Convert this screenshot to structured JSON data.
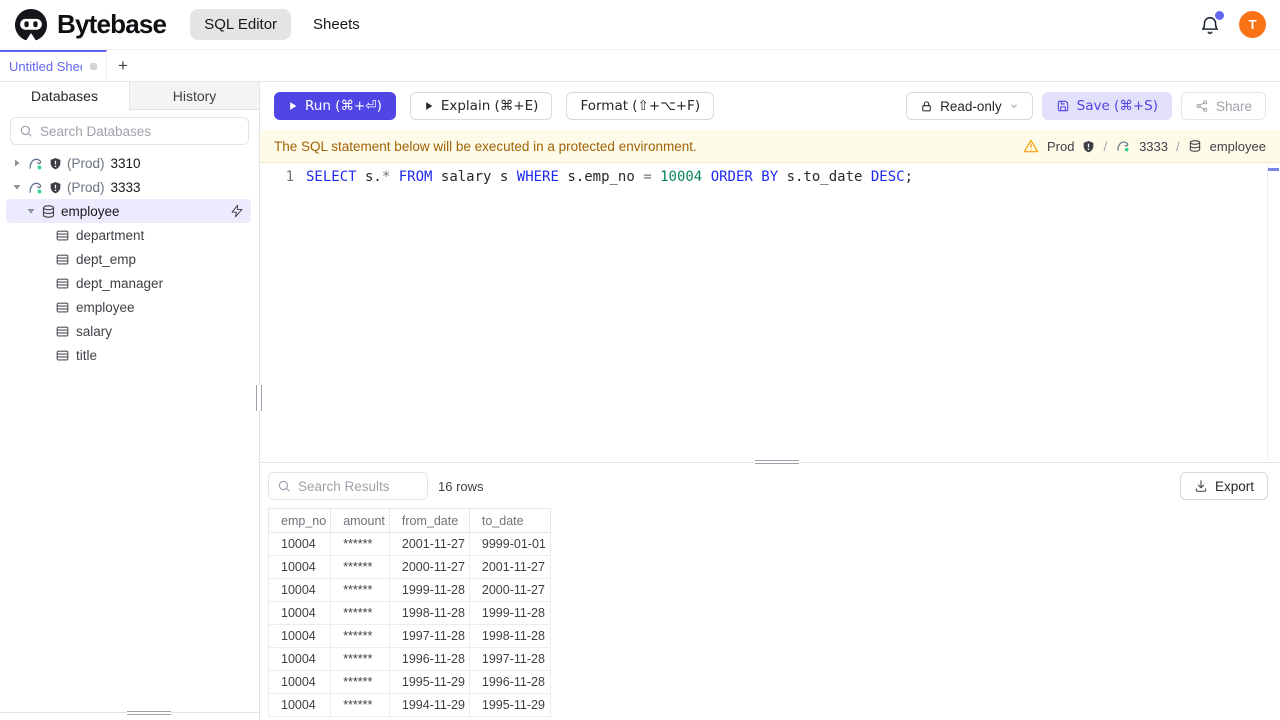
{
  "header": {
    "brand": "Bytebase",
    "nav": [
      {
        "label": "SQL Editor",
        "active": true
      },
      {
        "label": "Sheets",
        "active": false
      }
    ],
    "notifications_badge": true,
    "avatar_initial": "T"
  },
  "sheet_tabs": {
    "active_tab": "Untitled Sheet",
    "new_tab_label": "+"
  },
  "sidebar": {
    "tabs": [
      {
        "label": "Databases",
        "active": true
      },
      {
        "label": "History",
        "active": false
      }
    ],
    "search_placeholder": "Search Databases",
    "instances": [
      {
        "env": "(Prod)",
        "name": "3310",
        "expanded": false
      },
      {
        "env": "(Prod)",
        "name": "3333",
        "expanded": true,
        "databases": [
          {
            "name": "employee",
            "selected": true,
            "tables": [
              "department",
              "dept_emp",
              "dept_manager",
              "employee",
              "salary",
              "title"
            ]
          }
        ]
      }
    ]
  },
  "toolbar": {
    "run_label": "Run (⌘+⏎)",
    "explain_label": "Explain (⌘+E)",
    "format_label": "Format (⇧+⌥+F)",
    "readonly_label": "Read-only",
    "save_label": "Save (⌘+S)",
    "share_label": "Share"
  },
  "banner": {
    "message": "The SQL statement below will be executed in a protected environment.",
    "environment": "Prod",
    "separator": "/",
    "instance": "3333",
    "database": "employee"
  },
  "editor": {
    "line_number": "1",
    "sql_tokens": [
      {
        "text": "SELECT",
        "type": "keyword"
      },
      {
        "text": " s.",
        "type": "plain"
      },
      {
        "text": "*",
        "type": "operator"
      },
      {
        "text": " ",
        "type": "plain"
      },
      {
        "text": "FROM",
        "type": "keyword"
      },
      {
        "text": " salary s ",
        "type": "plain"
      },
      {
        "text": "WHERE",
        "type": "keyword"
      },
      {
        "text": " s.emp_no ",
        "type": "plain"
      },
      {
        "text": "=",
        "type": "operator"
      },
      {
        "text": " ",
        "type": "plain"
      },
      {
        "text": "10004",
        "type": "number"
      },
      {
        "text": " ",
        "type": "plain"
      },
      {
        "text": "ORDER",
        "type": "keyword"
      },
      {
        "text": " ",
        "type": "plain"
      },
      {
        "text": "BY",
        "type": "keyword"
      },
      {
        "text": " s.to_date ",
        "type": "plain"
      },
      {
        "text": "DESC",
        "type": "keyword"
      },
      {
        "text": ";",
        "type": "plain"
      }
    ]
  },
  "results": {
    "search_placeholder": "Search Results",
    "row_count_label": "16 rows",
    "export_label": "Export",
    "table": {
      "columns": [
        "emp_no",
        "amount",
        "from_date",
        "to_date"
      ],
      "rows": [
        [
          "10004",
          "******",
          "2001-11-27",
          "9999-01-01"
        ],
        [
          "10004",
          "******",
          "2000-11-27",
          "2001-11-27"
        ],
        [
          "10004",
          "******",
          "1999-11-28",
          "2000-11-27"
        ],
        [
          "10004",
          "******",
          "1998-11-28",
          "1999-11-28"
        ],
        [
          "10004",
          "******",
          "1997-11-28",
          "1998-11-28"
        ],
        [
          "10004",
          "******",
          "1996-11-28",
          "1997-11-28"
        ],
        [
          "10004",
          "******",
          "1995-11-29",
          "1996-11-28"
        ],
        [
          "10004",
          "******",
          "1994-11-29",
          "1995-11-29"
        ]
      ]
    }
  },
  "colors": {
    "accent": "#4f46e5",
    "accent_soft": "#e3e0fb",
    "sheet_tab_text": "#6366f1",
    "selected_tree_bg": "#eceafd",
    "warning_bg": "#fefce8",
    "warning_text": "#a16207",
    "warning_icon": "#f59e0b",
    "avatar_bg": "#f97316",
    "status_dot": "#34d399",
    "sql_keyword": "#1f2af0",
    "sql_number": "#098658",
    "sql_operator": "#6e7781",
    "sql_plain": "#24292e"
  }
}
